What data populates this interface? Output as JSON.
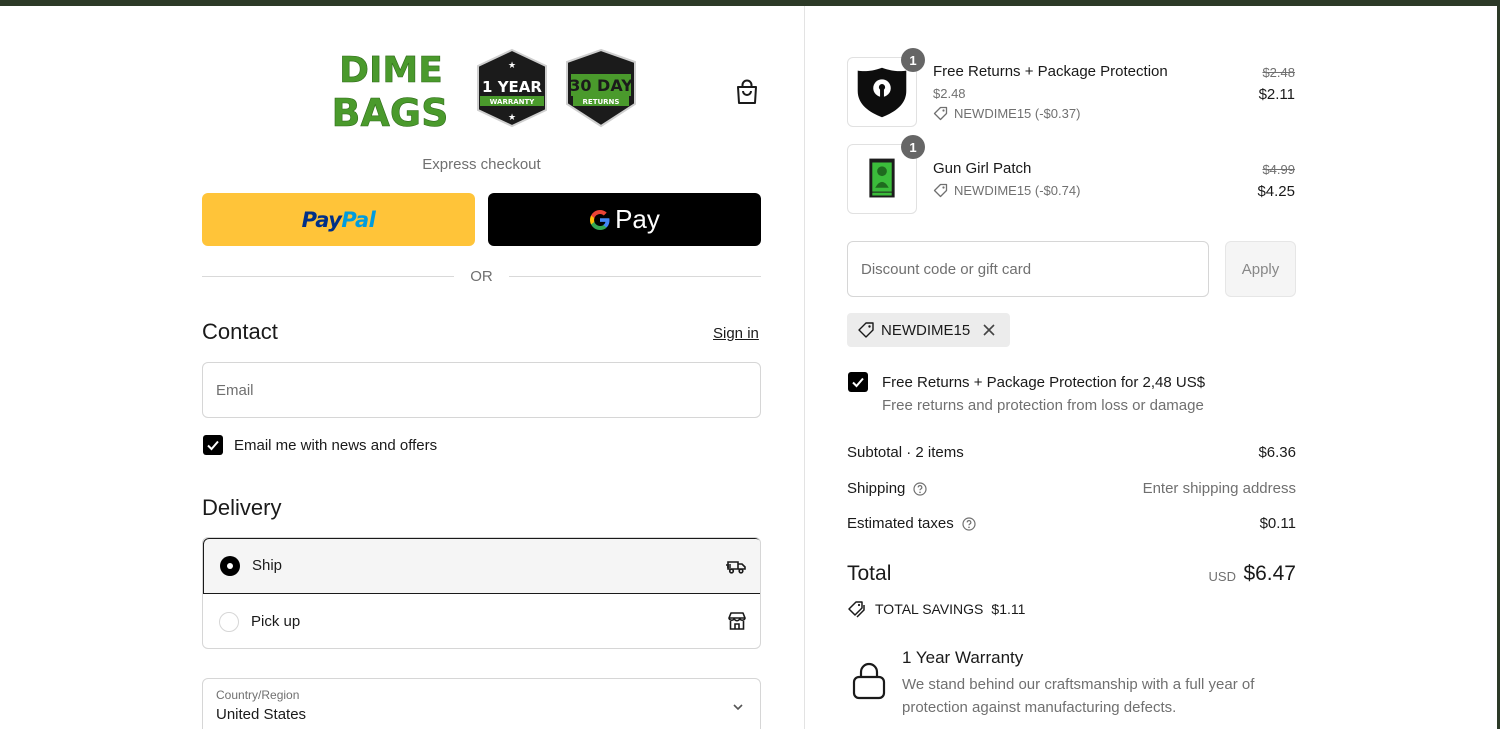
{
  "header": {
    "logo_text": [
      "DIME",
      "BAGS"
    ],
    "badge_warranty": {
      "line1": "1 YEAR",
      "line2": "WARRANTY"
    },
    "badge_returns": {
      "line1": "30 DAY",
      "line2": "RETURNS"
    },
    "cart_icon": "shopping-bag-icon"
  },
  "express": {
    "label": "Express checkout",
    "paypal": {
      "part1": "Pay",
      "part2": "Pal"
    },
    "gpay": {
      "label": "Pay"
    },
    "or_label": "OR"
  },
  "contact": {
    "title": "Contact",
    "sign_in": "Sign in",
    "email_placeholder": "Email",
    "newsletter_label": "Email me with news and offers",
    "newsletter_checked": true
  },
  "delivery": {
    "title": "Delivery",
    "options": [
      {
        "label": "Ship",
        "selected": true,
        "icon": "truck-icon"
      },
      {
        "label": "Pick up",
        "selected": false,
        "icon": "store-icon"
      }
    ],
    "country_label": "Country/Region",
    "country_value": "United States"
  },
  "order": {
    "items": [
      {
        "name": "Free Returns + Package Protection",
        "subtitle": "$2.48",
        "discount": "NEWDIME15 (-$0.37)",
        "price_original": "$2.48",
        "price": "$2.11",
        "quantity": "1"
      },
      {
        "name": "Gun Girl Patch",
        "discount": "NEWDIME15 (-$0.74)",
        "price_original": "$4.99",
        "price": "$4.25",
        "quantity": "1"
      }
    ],
    "discount_placeholder": "Discount code or gift card",
    "apply_label": "Apply",
    "applied_code": "NEWDIME15",
    "protection": {
      "label": "Free Returns + Package Protection for 2,48 US$",
      "description": "Free returns and protection from loss or damage",
      "checked": true
    },
    "summary": {
      "subtotal_label": "Subtotal · 2 items",
      "subtotal_value": "$6.36",
      "shipping_label": "Shipping",
      "shipping_value": "Enter shipping address",
      "taxes_label": "Estimated taxes",
      "taxes_value": "$0.11",
      "total_label": "Total",
      "currency": "USD",
      "total_value": "$6.47",
      "savings_label": "TOTAL SAVINGS",
      "savings_value": "$1.11"
    },
    "warranty": {
      "title": "1 Year Warranty",
      "description": "We stand behind our craftsmanship with a full year of protection against manufacturing defects."
    }
  },
  "colors": {
    "brand_green": "#4a9a2c",
    "topbar": "#2c3a27",
    "paypal_yellow": "#ffc439",
    "paypal_dark_blue": "#003087",
    "paypal_light_blue": "#009cde"
  }
}
